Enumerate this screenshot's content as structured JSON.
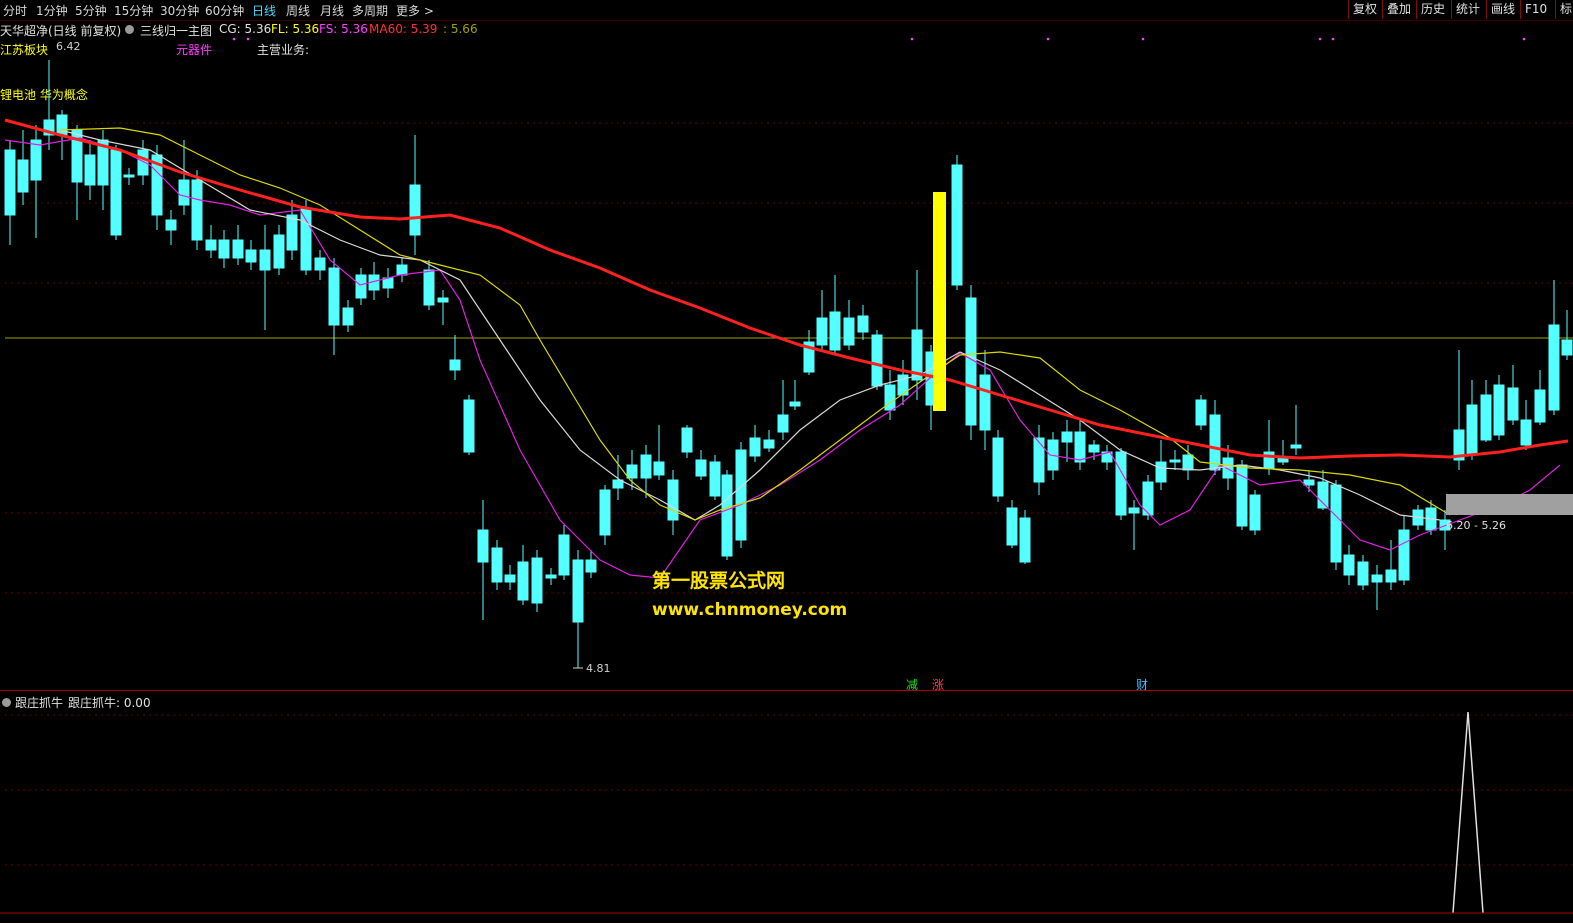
{
  "periods": [
    {
      "label": "分时",
      "active": false
    },
    {
      "label": "1分钟",
      "active": false
    },
    {
      "label": "5分钟",
      "active": false
    },
    {
      "label": "15分钟",
      "active": false
    },
    {
      "label": "30分钟",
      "active": false
    },
    {
      "label": "60分钟",
      "active": false
    },
    {
      "label": "日线",
      "active": true
    },
    {
      "label": "周线",
      "active": false
    },
    {
      "label": "月线",
      "active": false
    },
    {
      "label": "多周期",
      "active": false
    },
    {
      "label": "更多 >",
      "active": false
    }
  ],
  "right_buttons": [
    "复权",
    "叠加",
    "历史",
    "统计",
    "画线",
    "F10",
    "标"
  ],
  "info": {
    "stock_title": "天华超净(日线 前复权)",
    "indicator_name": "三线归一主图",
    "cg": "CG: 5.36",
    "fl": "FL: 5.36",
    "fs": "FS: 5.36",
    "ma60": "MA60: 5.39",
    "extra": ": 5.66"
  },
  "tags": {
    "region": "江苏板块",
    "concepts": "锂电池 华为概念",
    "sector": "元器件",
    "business": "主营业务:"
  },
  "annotations": {
    "high_price": "6.42",
    "low_price": "4.81",
    "range": "6.20 - 5.26",
    "event_1": "减",
    "event_2": "涨",
    "event_3": "财"
  },
  "watermark": {
    "line1": "第一股票公式网",
    "line2": "www.chnmoney.com"
  },
  "sub_panel": {
    "name": "跟庄抓牛",
    "value_label": "跟庄抓牛: 0.00"
  },
  "colors": {
    "up": "#ff3232",
    "down": "#54ffff",
    "ma60": "#ff2020",
    "white_line": "#d8d8d8",
    "yellow_line": "#d8d800",
    "magenta_line": "#e020e0",
    "signal_bar": "#ffff00",
    "zone_box": "#a0a0a0"
  },
  "chart_data": {
    "type": "candlestick",
    "title": "天华超净(日线 前复权)",
    "y_range": [
      4.81,
      6.42
    ],
    "series_ma60": [
      6.3,
      6.25,
      6.2,
      6.15,
      6.12,
      6.1,
      6.1,
      6.05,
      5.95,
      5.8,
      5.65,
      5.5,
      5.45,
      5.39,
      5.32,
      5.28,
      5.22,
      5.18,
      5.18,
      5.2
    ],
    "signal_subpanel": {
      "name": "跟庄抓牛",
      "value": 0.0,
      "spike_near_end": true
    }
  }
}
